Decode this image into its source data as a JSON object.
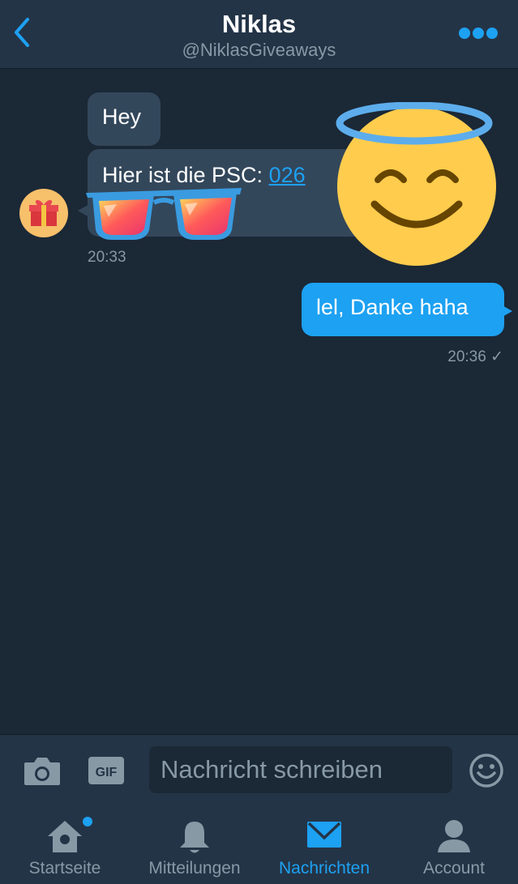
{
  "header": {
    "title": "Niklas",
    "handle": "@NiklasGiveaways"
  },
  "conversation": {
    "incoming": [
      {
        "text": "Hey"
      },
      {
        "prefix": "Hier ist die PSC: ",
        "link": "026"
      }
    ],
    "incoming_time": "20:33",
    "outgoing": {
      "text": "lel, Danke haha"
    },
    "outgoing_time": "20:36 ✓"
  },
  "composer": {
    "placeholder": "Nachricht schreiben",
    "gif_label": "GIF"
  },
  "tabs": [
    {
      "label": "Startseite",
      "icon": "home-icon"
    },
    {
      "label": "Mitteilungen",
      "icon": "bell-icon"
    },
    {
      "label": "Nachrichten",
      "icon": "envelope-icon",
      "active": true
    },
    {
      "label": "Account",
      "icon": "person-icon"
    }
  ],
  "colors": {
    "accent": "#1da1f2",
    "background": "#1b2836",
    "bar": "#243447",
    "incoming_bubble": "#33475b",
    "muted_text": "#8899a6"
  }
}
